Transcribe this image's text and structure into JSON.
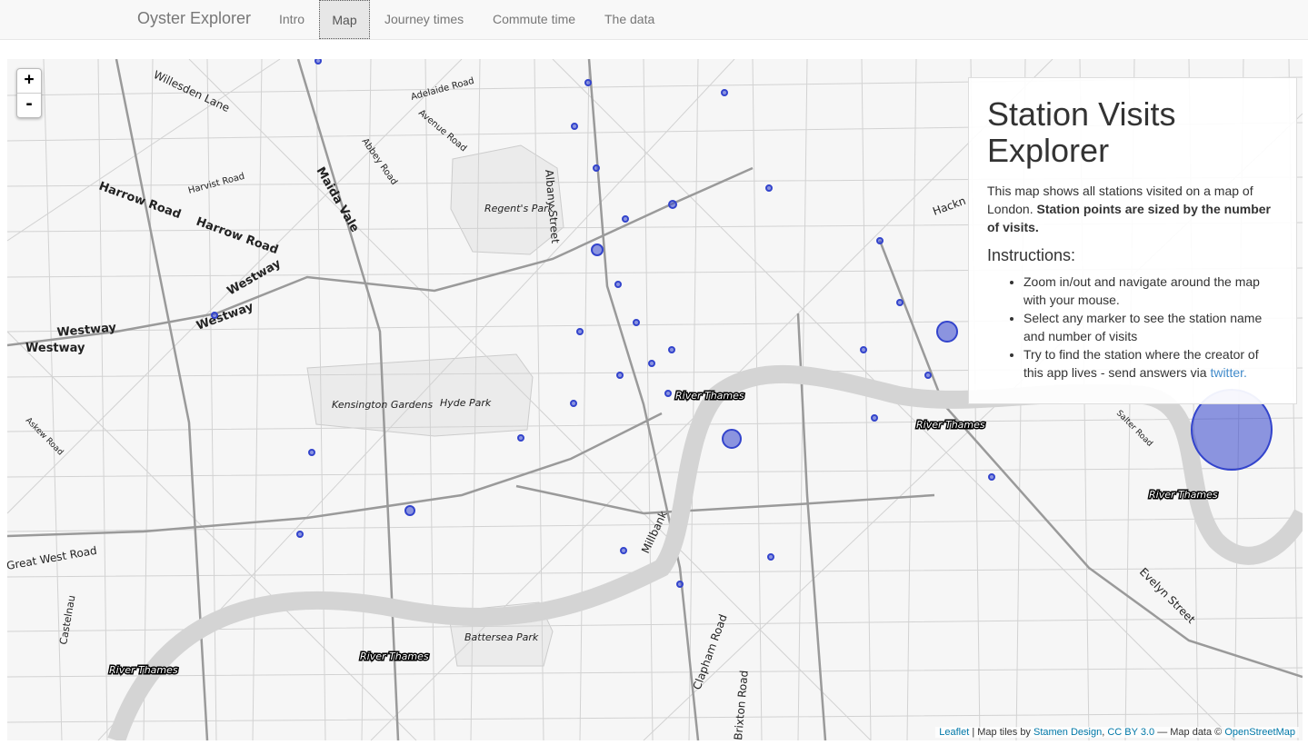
{
  "navbar": {
    "brand": "Oyster Explorer",
    "links": [
      "Intro",
      "Map",
      "Journey times",
      "Commute time",
      "The data"
    ],
    "active": "Map"
  },
  "map": {
    "zoom_in": "+",
    "zoom_out": "-",
    "park_labels": [
      "Regent's Park",
      "Kensington Gardens",
      "Hyde Park",
      "Battersea Park"
    ],
    "road_labels": [
      "Willesden Lane",
      "Adelaide Road",
      "Avenue Road",
      "Abbey Road",
      "Albany Street",
      "Harvist Road",
      "Harrow Road",
      "Harrow Road",
      "Maida Vale",
      "Westway",
      "Westway",
      "Westway",
      "Westway",
      "Askew Road",
      "Great West Road",
      "Castelnau",
      "Millbank",
      "Clapham Road",
      "Brixton Road",
      "Evelyn Street",
      "Salter Road",
      "Hackn"
    ],
    "river_labels": [
      "River Thames",
      "River Thames",
      "River Thames",
      "River Thames",
      "River Thames"
    ],
    "station_marker_color": "#3344cc"
  },
  "panel": {
    "title": "Station Visits Explorer",
    "intro": "This map shows all stations visited on a map of London.",
    "intro_bold": "Station points are sized by the number of visits.",
    "instructions_heading": "Instructions:",
    "instructions": [
      "Zoom in/out and navigate around the map with your mouse.",
      "Select any marker to see the station name and number of visits",
      "Try to find the station where the creator of this app lives - send answers via"
    ],
    "twitter_link": "twitter."
  },
  "attribution": {
    "leaflet": "Leaflet",
    "tiles_prefix": "| Map tiles by",
    "stamen": "Stamen Design",
    "sep": ",",
    "license": "CC BY 3.0",
    "mapdata_prefix": "— Map data ©",
    "osm": "OpenStreetMap"
  }
}
